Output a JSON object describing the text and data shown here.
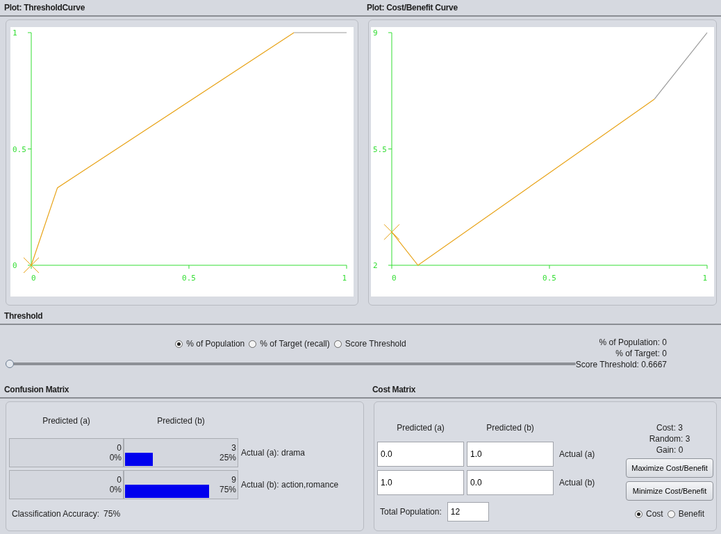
{
  "plots": [
    {
      "title": "Plot: ThresholdCurve",
      "chart_data": {
        "type": "line",
        "x": [
          0,
          0.083,
          0.833,
          1
        ],
        "series": [
          {
            "color": "#e8a317",
            "values": [
              0,
              0.333,
              1,
              null
            ]
          },
          {
            "color": "#999999",
            "values": [
              null,
              null,
              1,
              1
            ]
          }
        ],
        "xlim": [
          0,
          1
        ],
        "ylim": [
          0,
          1
        ],
        "xticks": [
          0,
          0.5,
          1
        ],
        "yticks": [
          0,
          0.5,
          1
        ]
      }
    },
    {
      "title": "Plot: Cost/Benefit Curve",
      "chart_data": {
        "type": "line",
        "x": [
          0,
          0.083,
          0.833,
          1
        ],
        "series": [
          {
            "color": "#e8a317",
            "values": [
              3,
              2,
              7,
              null
            ]
          },
          {
            "color": "#999999",
            "values": [
              null,
              null,
              7,
              9
            ]
          }
        ],
        "xlim": [
          0,
          1
        ],
        "ylim": [
          2,
          9
        ],
        "xticks": [
          0,
          0.5,
          1
        ],
        "yticks": [
          2,
          5.5,
          9
        ]
      }
    }
  ],
  "threshold": {
    "title": "Threshold",
    "options": [
      {
        "label": "% of Population",
        "selected": true
      },
      {
        "label": "% of Target (recall)",
        "selected": false
      },
      {
        "label": "Score Threshold",
        "selected": false
      }
    ],
    "slider": {
      "level": 0
    },
    "readouts": [
      "% of Population: 0",
      "% of Target: 0",
      "Score Threshold: 0.6667"
    ]
  },
  "confusion_matrix": {
    "title": "Confusion Matrix",
    "columns": [
      "Predicted (a)",
      "Predicted (b)"
    ],
    "rows": [
      {
        "label": "Actual (a): drama",
        "cells": [
          {
            "count": "0",
            "percent": "0%"
          },
          {
            "count": "3",
            "percent": "25%",
            "level": 0.25
          }
        ]
      },
      {
        "label": "Actual (b): action,romance",
        "cells": [
          {
            "count": "0",
            "percent": "0%"
          },
          {
            "count": "9",
            "percent": "75%",
            "level": 0.75
          }
        ]
      }
    ],
    "accuracy_label": "Classification Accuracy:",
    "accuracy_value": "75%"
  },
  "cost_matrix": {
    "title": "Cost Matrix",
    "columns": [
      "Predicted (a)",
      "Predicted (b)"
    ],
    "rows": [
      {
        "label": "Actual (a)",
        "values": [
          "0.0",
          "1.0"
        ]
      },
      {
        "label": "Actual (b)",
        "values": [
          "1.0",
          "0.0"
        ]
      }
    ],
    "total_population_label": "Total Population:",
    "total_population": "12",
    "stats": [
      "Cost: 3",
      "Random: 3",
      "Gain: 0"
    ],
    "buttons": [
      "Maximize Cost/Benefit",
      "Minimize Cost/Benefit"
    ],
    "mode": [
      {
        "label": "Cost",
        "selected": true
      },
      {
        "label": "Benefit",
        "selected": false
      }
    ]
  }
}
